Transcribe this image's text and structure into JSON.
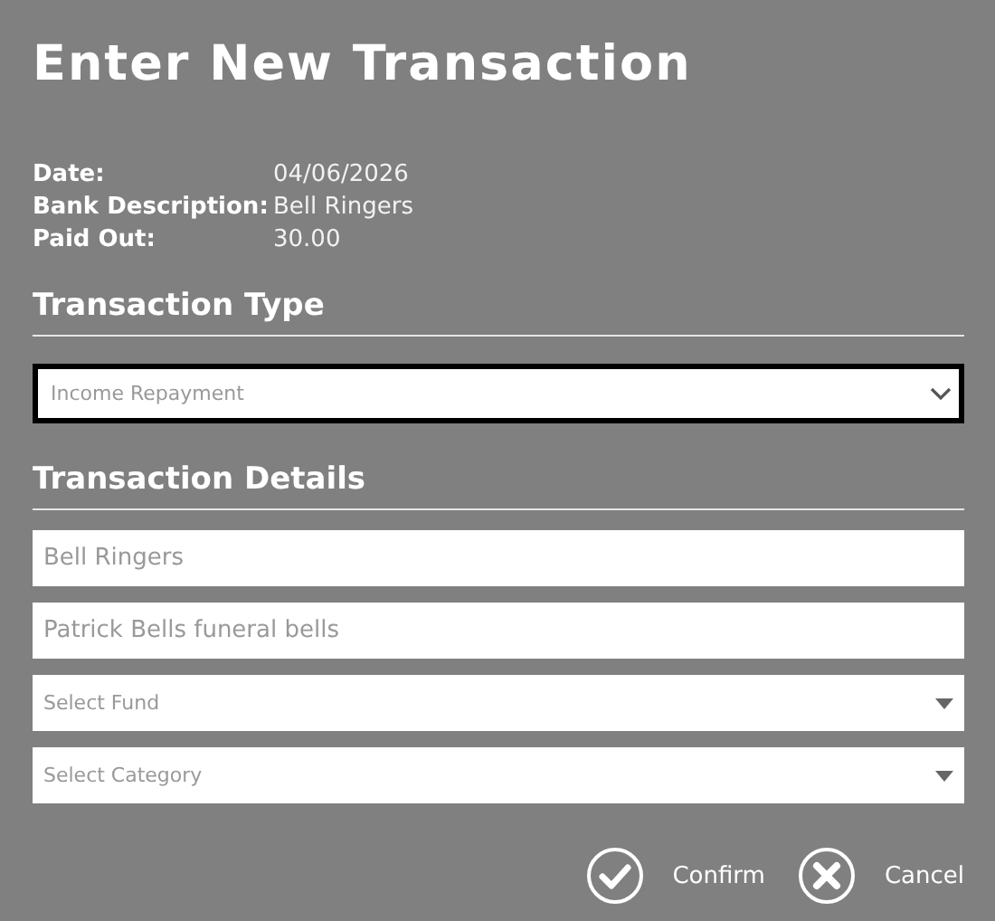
{
  "title": "Enter New Transaction",
  "info": [
    {
      "label": "Date:",
      "value": "04/06/2026"
    },
    {
      "label": "Bank Description:",
      "value": "Bell Ringers"
    },
    {
      "label": "Paid Out:",
      "value": "30.00"
    }
  ],
  "transaction_type": {
    "heading": "Transaction Type",
    "value": "Income Repayment",
    "focused": true
  },
  "transaction_details": {
    "heading": "Transaction Details",
    "fields": [
      {
        "kind": "text",
        "value": "Bell Ringers"
      },
      {
        "kind": "text",
        "value": "Patrick Bells funeral bells"
      },
      {
        "kind": "select",
        "placeholder": "Select Fund"
      },
      {
        "kind": "select",
        "placeholder": "Select Category"
      }
    ]
  },
  "buttons": [
    {
      "kind": "confirm",
      "label": "Confirm"
    },
    {
      "kind": "cancel",
      "label": "Cancel"
    }
  ]
}
